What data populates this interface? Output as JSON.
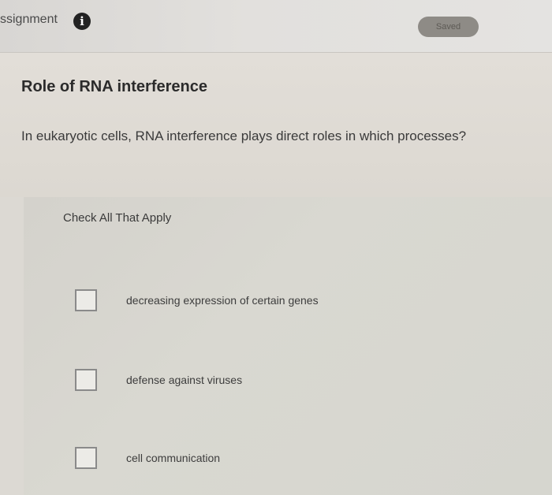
{
  "header": {
    "title": "ssignment",
    "info_icon": "info-icon",
    "status_label": "Saved"
  },
  "question": {
    "title": "Role of RNA interference",
    "text": "In eukaryotic cells, RNA interference plays direct roles in which processes?",
    "instruction": "Check All That Apply",
    "options": [
      {
        "label": "decreasing expression of certain genes",
        "checked": false
      },
      {
        "label": "defense against viruses",
        "checked": false
      },
      {
        "label": "cell communication",
        "checked": false
      }
    ]
  }
}
